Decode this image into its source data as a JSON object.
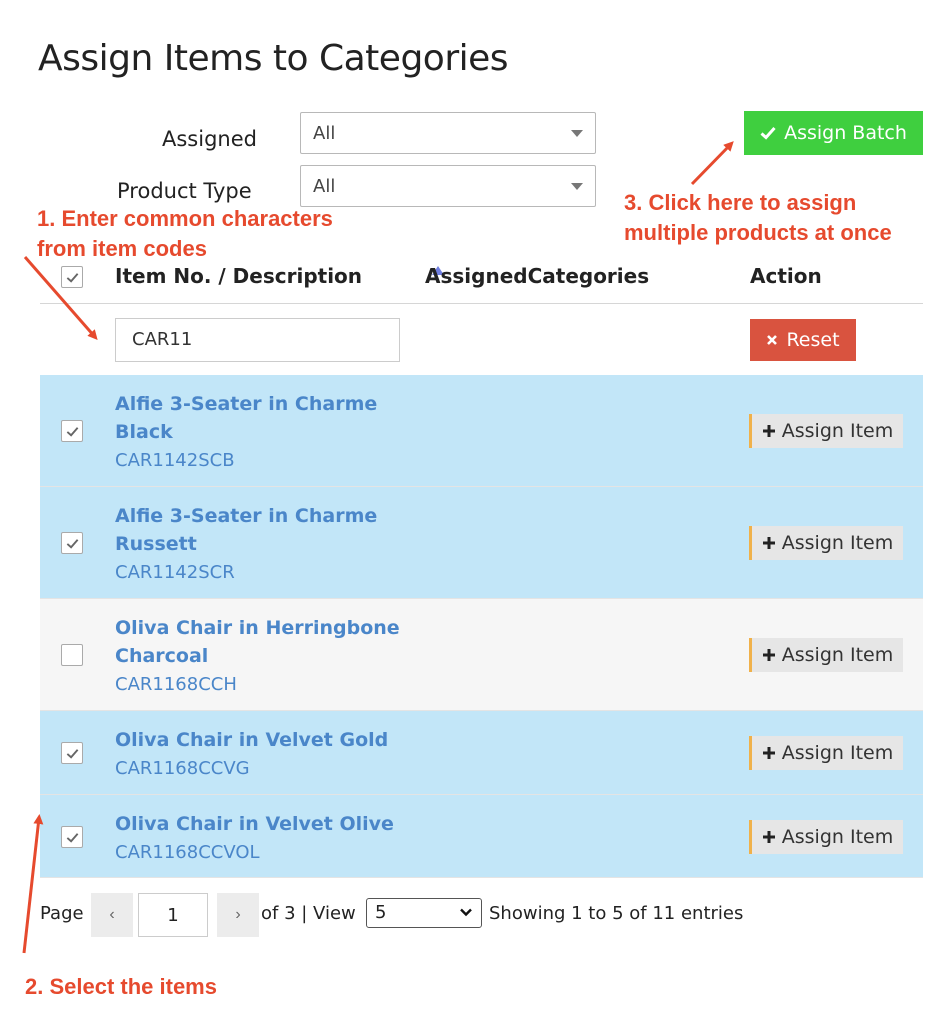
{
  "page": {
    "title": "Assign Items to Categories"
  },
  "filters": {
    "assigned": {
      "label": "Assigned",
      "value": "All"
    },
    "product_type": {
      "label": "Product Type",
      "value": "All"
    }
  },
  "toolbar": {
    "assign_batch_label": "Assign Batch"
  },
  "annotations": {
    "step1": "1. Enter common characters\nfrom item codes",
    "step2": "2. Select the items",
    "step3": "3. Click here to assign\nmultiple products at once"
  },
  "table": {
    "columns": {
      "item": "Item No. / Description",
      "categories": "AssignedCategories",
      "action": "Action"
    },
    "search_value": "CAR11",
    "reset_label": "Reset",
    "assign_item_label": "Assign Item",
    "rows": [
      {
        "name": "Alfie 3-Seater in Charme Black",
        "code": "CAR1142SCB",
        "checked": true
      },
      {
        "name": "Alfie 3-Seater in Charme Russett",
        "code": "CAR1142SCR",
        "checked": true
      },
      {
        "name": "Oliva Chair in Herringbone Charcoal",
        "code": "CAR1168CCH",
        "checked": false
      },
      {
        "name": "Oliva Chair in Velvet Gold",
        "code": "CAR1168CCVG",
        "checked": true
      },
      {
        "name": "Oliva Chair in Velvet Olive",
        "code": "CAR1168CCVOL",
        "checked": true
      }
    ]
  },
  "pagination": {
    "page_label": "Page",
    "current_page": "1",
    "of_pages": "of 3 | View",
    "view_value": "5",
    "showing": "Showing 1 to 5 of 11 entries"
  },
  "colors": {
    "accent_green": "#3fcf3f",
    "reset_red": "#d9533f",
    "selected_row": "#c2e6f8",
    "annotation_red": "#e64a2e",
    "link_blue": "#4a86c9"
  }
}
